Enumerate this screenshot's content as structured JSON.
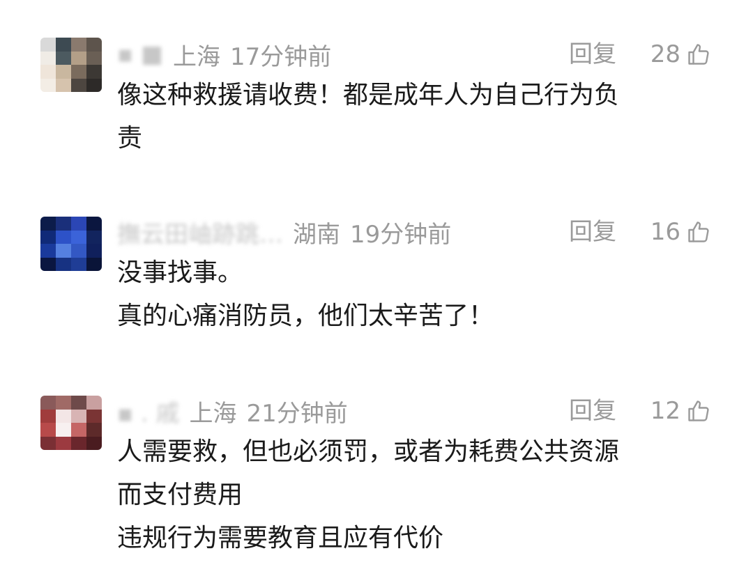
{
  "comments": [
    {
      "username": "▪ ■",
      "location": "上海",
      "time": "17分钟前",
      "reply_label": "回复",
      "like_count": "28",
      "lines": [
        "像这种救援请收费！都是成年人为自己行为负",
        "责"
      ],
      "avatar_colors": [
        "#d9d9d9",
        "#3d4a52",
        "#8a7a6e",
        "#5d544c",
        "#f0ece6",
        "#4c5a60",
        "#b39f88",
        "#6a5f55",
        "#efe5da",
        "#c9b79f",
        "#7a6b5d",
        "#3c3834",
        "#f3ede5",
        "#d6c3ad",
        "#4d4640",
        "#2d2a28"
      ]
    },
    {
      "username": "撫云田岫跡跳…",
      "location": "湖南",
      "time": "19分钟前",
      "reply_label": "回复",
      "like_count": "16",
      "lines": [
        "没事找事。",
        "真的心痛消防员，他们太辛苦了！"
      ],
      "avatar_colors": [
        "#0c1c4a",
        "#1a2f7a",
        "#2b46b5",
        "#0b163f",
        "#102a78",
        "#2d52c8",
        "#3b63d9",
        "#12245e",
        "#1a3a9c",
        "#5580e0",
        "#3358c4",
        "#10205c",
        "#0a1640",
        "#173282",
        "#1f3d96",
        "#0a1438"
      ]
    },
    {
      "username": "▪ . 戚",
      "location": "上海",
      "time": "21分钟前",
      "reply_label": "回复",
      "like_count": "12",
      "lines": [
        "人需要救，但也必须罚，或者为耗费公共资源",
        "而支付费用",
        "违规行为需要教育且应有代价"
      ],
      "avatar_colors": [
        "#8a5a5a",
        "#a06a66",
        "#6e4a4a",
        "#c9a0a0",
        "#a03c3c",
        "#f3e6e6",
        "#d8b4b4",
        "#7a3434",
        "#b84a4a",
        "#f7f0f0",
        "#c56666",
        "#5d2a2a",
        "#7a2f34",
        "#9c3a40",
        "#6a262c",
        "#4a1c20"
      ]
    }
  ]
}
